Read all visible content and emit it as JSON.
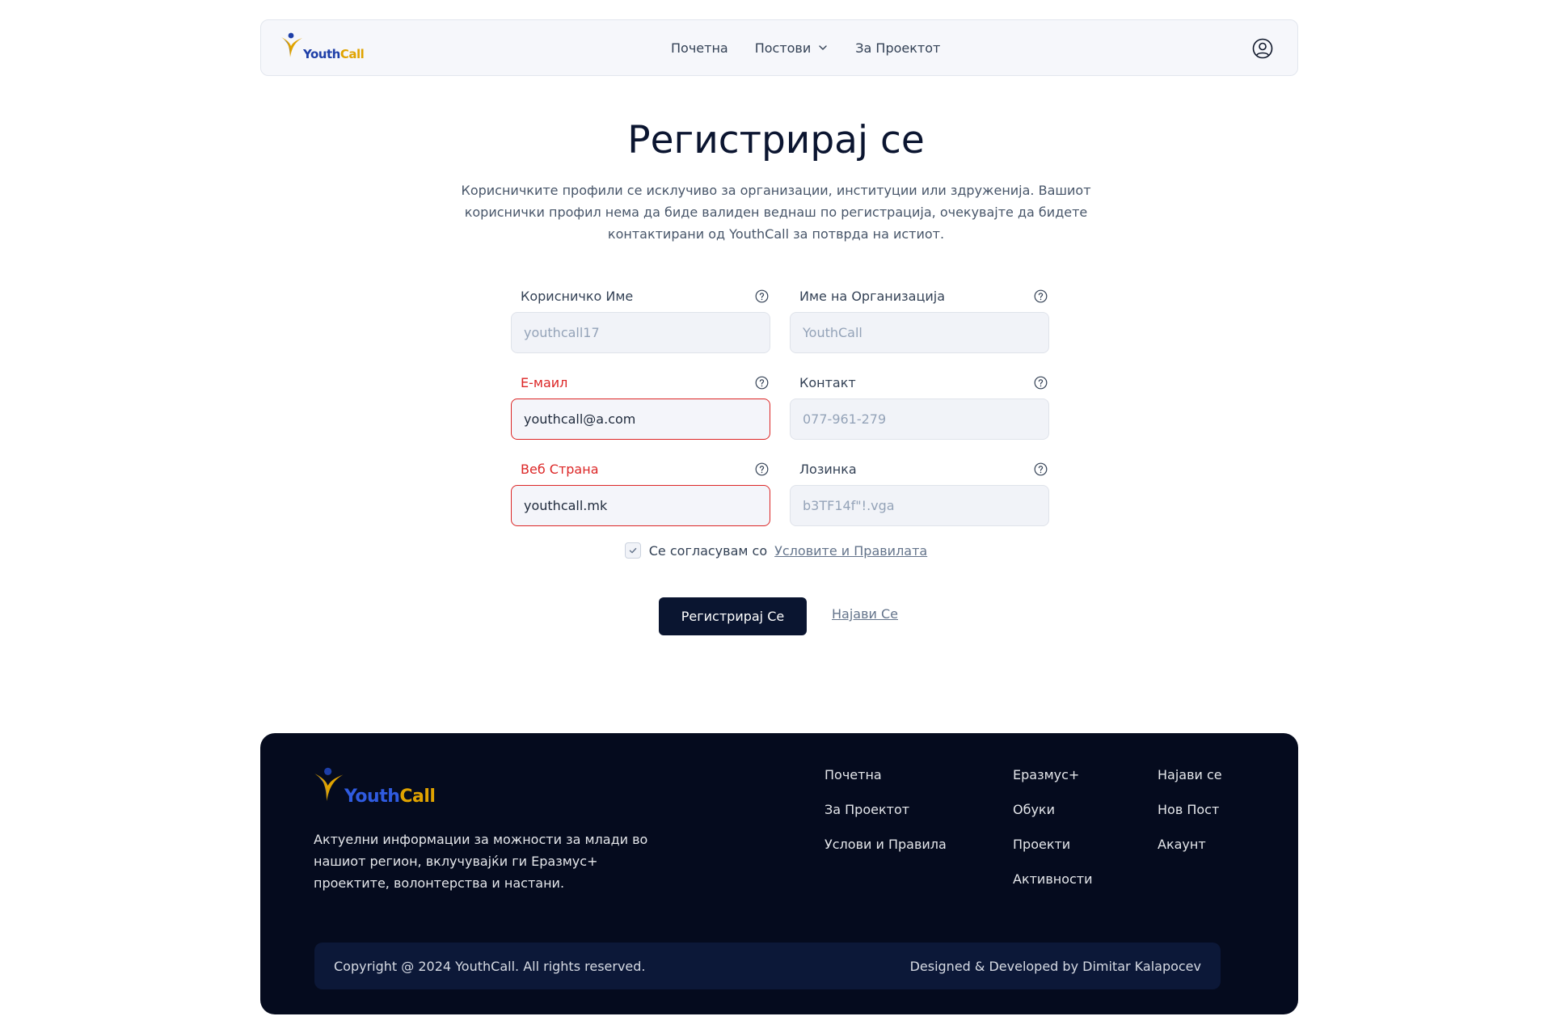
{
  "brand": {
    "name_part1": "Youth",
    "name_part2": "Call",
    "colors": {
      "blue": "#1e3fa8",
      "gold": "#e0a300"
    }
  },
  "nav": {
    "items": [
      "Почетна",
      "Постови",
      "За Проектот"
    ],
    "posts_has_dropdown": true,
    "user_icon": "user-circle-icon"
  },
  "page": {
    "title": "Регистрирај се",
    "description": "Корисничките профили се исклучиво за организации, институции или здруженија. Вашиот кориснички профил нема да биде валиден веднаш по регистрација, очекувајте да бидете контактирани од YouthCall за потврда на истиот."
  },
  "form": {
    "username": {
      "label": "Корисничко Име",
      "placeholder": "youthcall17",
      "value": ""
    },
    "organization": {
      "label": "Име на Организација",
      "placeholder": "YouthCall",
      "value": ""
    },
    "email": {
      "label": "Е-маил",
      "placeholder": "",
      "value": "youthcall@a.com",
      "error": true
    },
    "contact": {
      "label": "Контакт",
      "placeholder": "077-961-279",
      "value": ""
    },
    "website": {
      "label": "Веб Страна",
      "placeholder": "",
      "value": "youthcall.mk",
      "error": true
    },
    "password": {
      "label": "Лозинка",
      "placeholder": "b3TF14f\"!.vga",
      "value": ""
    },
    "terms_text": "Се согласувам со",
    "terms_link": "Условите и Правилата",
    "terms_checked": true,
    "submit_label": "Регистрирај Се",
    "login_link": "Најави Се",
    "error_color": "#dc2626"
  },
  "footer": {
    "description": "Актуелни информации за можности за млади во нашиот регион, вклучувајќи ги Еразмус+ проектите, волонтерства и настани.",
    "col1": [
      "Почетна",
      "За Проектот",
      "Услови и Правила"
    ],
    "col2": [
      "Еразмус+",
      "Обуки",
      "Проекти",
      "Активности"
    ],
    "col3": [
      "Најави се",
      "Нов Пост",
      "Акаунт"
    ],
    "copyright": "Copyright @ 2024 YouthCall. All rights reserved.",
    "credit": "Designed & Developed by Dimitar Kalapocev",
    "background": "#050b1e"
  }
}
